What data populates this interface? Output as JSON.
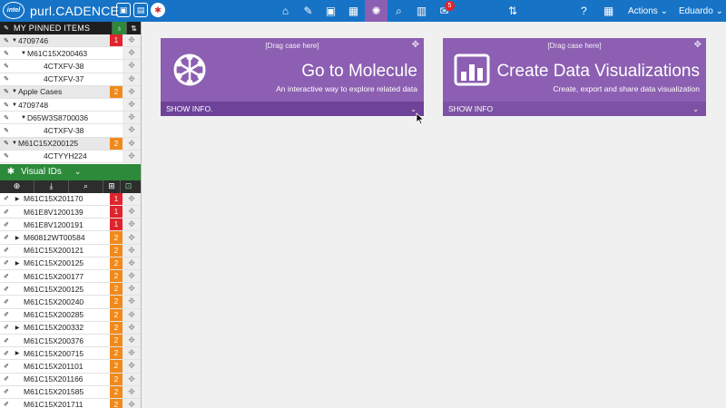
{
  "header": {
    "logo_text": "intel",
    "app_title": "purl.CADENCE",
    "nav_badge": "5",
    "actions_label": "Actions",
    "user_label": "Eduardo"
  },
  "pinned": {
    "title": "MY PINNED ITEMS",
    "items": [
      {
        "label": "4709746",
        "indent": 0,
        "caret": "down",
        "group": true,
        "count": "1",
        "count_color": "red"
      },
      {
        "label": "M61C15X200463",
        "indent": 1,
        "caret": "down",
        "group": false,
        "count": "",
        "count_color": "empty"
      },
      {
        "label": "4CTXFV-38",
        "indent": 2,
        "caret": "",
        "group": false,
        "count": "",
        "count_color": "empty"
      },
      {
        "label": "4CTXFV-37",
        "indent": 2,
        "caret": "",
        "group": false,
        "count": "",
        "count_color": "empty"
      },
      {
        "label": "Apple Cases",
        "indent": 0,
        "caret": "down",
        "group": true,
        "count": "2",
        "count_color": "orange"
      },
      {
        "label": "4709748",
        "indent": 0,
        "caret": "down",
        "group": false,
        "count": "",
        "count_color": "empty"
      },
      {
        "label": "D65W3S8700036",
        "indent": 1,
        "caret": "down",
        "group": false,
        "count": "",
        "count_color": "empty"
      },
      {
        "label": "4CTXFV-38",
        "indent": 2,
        "caret": "",
        "group": false,
        "count": "",
        "count_color": "empty"
      },
      {
        "label": "M61C15X200125",
        "indent": 0,
        "caret": "down",
        "group": true,
        "count": "2",
        "count_color": "orange"
      },
      {
        "label": "4CTYYH224",
        "indent": 2,
        "caret": "",
        "group": false,
        "count": "",
        "count_color": "empty"
      }
    ]
  },
  "visual_ids": {
    "title": "Visual IDs",
    "items": [
      {
        "label": "M61C15X201170",
        "caret": "right",
        "count": "1",
        "count_color": "red"
      },
      {
        "label": "M61E8V1200139",
        "caret": "",
        "count": "1",
        "count_color": "red"
      },
      {
        "label": "M61E8V1200191",
        "caret": "",
        "count": "1",
        "count_color": "red"
      },
      {
        "label": "M60812WT00584",
        "caret": "right",
        "count": "2",
        "count_color": "orange"
      },
      {
        "label": "M61C15X200121",
        "caret": "",
        "count": "2",
        "count_color": "orange"
      },
      {
        "label": "M61C15X200125",
        "caret": "right",
        "count": "2",
        "count_color": "orange"
      },
      {
        "label": "M61C15X200177",
        "caret": "",
        "count": "2",
        "count_color": "orange"
      },
      {
        "label": "M61C15X200125",
        "caret": "",
        "count": "2",
        "count_color": "orange"
      },
      {
        "label": "M61C15X200240",
        "caret": "",
        "count": "2",
        "count_color": "orange"
      },
      {
        "label": "M61C15X200285",
        "caret": "",
        "count": "2",
        "count_color": "orange"
      },
      {
        "label": "M61C15X200332",
        "caret": "right",
        "count": "2",
        "count_color": "orange"
      },
      {
        "label": "M61C15X200376",
        "caret": "",
        "count": "2",
        "count_color": "orange"
      },
      {
        "label": "M61C15X200715",
        "caret": "right",
        "count": "2",
        "count_color": "orange"
      },
      {
        "label": "M61C15X201101",
        "caret": "",
        "count": "2",
        "count_color": "orange"
      },
      {
        "label": "M61C15X201166",
        "caret": "",
        "count": "2",
        "count_color": "orange"
      },
      {
        "label": "M61C15X201585",
        "caret": "",
        "count": "2",
        "count_color": "orange"
      },
      {
        "label": "M61C15X201711",
        "caret": "",
        "count": "2",
        "count_color": "orange"
      }
    ]
  },
  "cards": [
    {
      "drag_text": "[Drag case here]",
      "title": "Go to Molecule",
      "subtitle": "An interactive way to explore related data",
      "footer": "SHOW INFO."
    },
    {
      "drag_text": "[Drag case here]",
      "title": "Create Data Visualizations",
      "subtitle": "Create, export and share data visualization",
      "footer": "SHOW INFO"
    }
  ],
  "colors": {
    "topbar": "#1673c6",
    "card": "#8c5fb2",
    "card_footer": "#6d4298",
    "visual_ids_header": "#2c8a3a",
    "count_red": "#e0242d",
    "count_orange": "#f08a1d"
  }
}
